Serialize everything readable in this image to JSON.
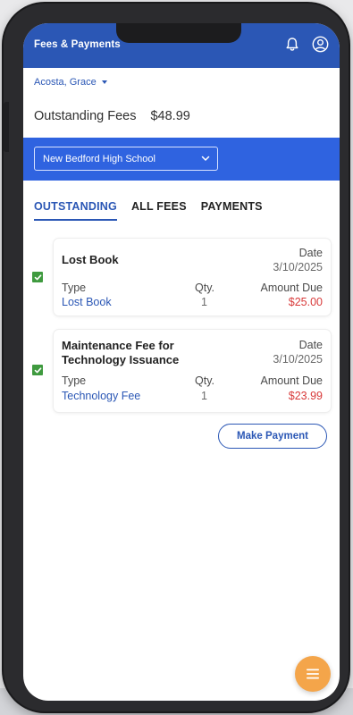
{
  "appbar": {
    "title": "Fees & Payments",
    "icons": [
      "bell-icon",
      "account-icon"
    ]
  },
  "student": {
    "name": "Acosta, Grace"
  },
  "summary": {
    "label": "Outstanding Fees",
    "amount": "$48.99"
  },
  "school": {
    "selected": "New Bedford High School"
  },
  "tabs": [
    {
      "label": "OUTSTANDING",
      "active": true
    },
    {
      "label": "ALL FEES",
      "active": false
    },
    {
      "label": "PAYMENTS",
      "active": false
    }
  ],
  "fees": [
    {
      "name_line1": "Lost Book",
      "name_line2": "",
      "date_label": "Date",
      "date": "3/10/2025",
      "type_label": "Type",
      "type": "Lost Book",
      "qty_label": "Qty.",
      "qty": "1",
      "amount_label": "Amount Due",
      "amount": "$25.00",
      "checked": true
    },
    {
      "name_line1": "Maintenance Fee for",
      "name_line2": "Technology Issuance",
      "date_label": "Date",
      "date": "3/10/2025",
      "type_label": "Type",
      "type": "Technology Fee",
      "qty_label": "Qty.",
      "qty": "1",
      "amount_label": "Amount Due",
      "amount": "$23.99",
      "checked": true
    }
  ],
  "actions": {
    "make_payment": "Make Payment"
  },
  "colors": {
    "primary": "#2b57b5",
    "band": "#2f63e0",
    "amount_red": "#d83a3a",
    "check_green": "#3f9a3f",
    "fab_orange": "#f4a54a"
  }
}
